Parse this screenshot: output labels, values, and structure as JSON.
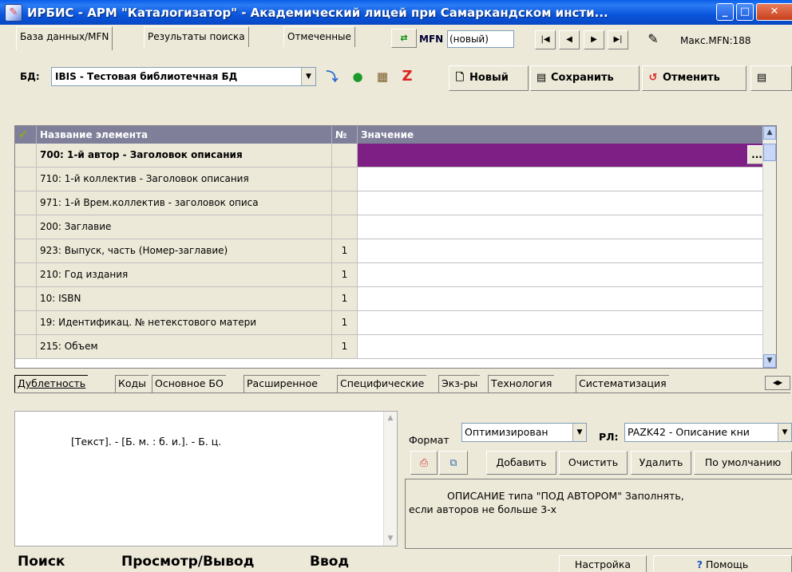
{
  "window": {
    "title": "ИРБИС - АРМ \"Каталогизатор\" - Академический лицей при Самаркандском инсти..."
  },
  "top_tabs": [
    {
      "label": "База данных/MFN"
    },
    {
      "label": "Результаты поиска"
    },
    {
      "label": "Отмеченные"
    }
  ],
  "mfn": {
    "label": "MFN",
    "value": "(новый)",
    "max_label": "Макс.MFN:188"
  },
  "db": {
    "label": "БД:",
    "selected": "IBIS - Тестовая библиотечная БД"
  },
  "actions": {
    "new": "Новый",
    "save": "Сохранить",
    "cancel": "Отменить"
  },
  "grid": {
    "headers": {
      "name": "Название элемента",
      "num": "№",
      "value": "Значение"
    },
    "rows": [
      {
        "name": "700: 1-й  автор - Заголовок описания",
        "num": "",
        "value": ""
      },
      {
        "name": "710: 1-й коллектив - Заголовок описания",
        "num": "",
        "value": ""
      },
      {
        "name": "971: 1-й Врем.коллектив - заголовок описа",
        "num": "",
        "value": ""
      },
      {
        "name": "200: Заглавие",
        "num": "",
        "value": ""
      },
      {
        "name": "923: Выпуск, часть (Номер-заглавие)",
        "num": "1",
        "value": ""
      },
      {
        "name": "210: Год издания",
        "num": "1",
        "value": ""
      },
      {
        "name": "10: ISBN",
        "num": "1",
        "value": ""
      },
      {
        "name": "19: Идентификац. № нетекстового матери",
        "num": "1",
        "value": ""
      },
      {
        "name": "215: Объем",
        "num": "1",
        "value": ""
      }
    ],
    "ellipsis": "..."
  },
  "sub_tabs": [
    {
      "label": "Дублетность"
    },
    {
      "label": "Коды"
    },
    {
      "label": "Основное БО"
    },
    {
      "label": "Расширенное"
    },
    {
      "label": "Специфические"
    },
    {
      "label": "Экз-ры"
    },
    {
      "label": "Технология"
    },
    {
      "label": "Систематизация"
    }
  ],
  "preview": {
    "text": "[Текст]. - [Б. м. : б. и.]. - Б. ц."
  },
  "format": {
    "label": "Формат",
    "selected": "Оптимизирован",
    "rl_label": "РЛ:",
    "rl_selected": "PAZK42 - Описание кни"
  },
  "panel_buttons": {
    "add": "Добавить",
    "clear": "Очистить",
    "delete": "Удалить",
    "default": "По умолчанию"
  },
  "description": {
    "line1": "ОПИСАНИЕ типа \"ПОД АВТОРОМ\"     Заполнять,",
    "line2": "если авторов не больше 3-х"
  },
  "bottom_tabs": [
    {
      "label": "Поиск"
    },
    {
      "label": "Просмотр/Вывод"
    },
    {
      "label": "Ввод"
    }
  ],
  "bottom_buttons": {
    "settings": "Настройка",
    "help": "Помощь"
  },
  "colors": {
    "titlebar": "#0a55dc",
    "selected_value": "#7d1f84",
    "grid_header": "#7f7f9a"
  }
}
